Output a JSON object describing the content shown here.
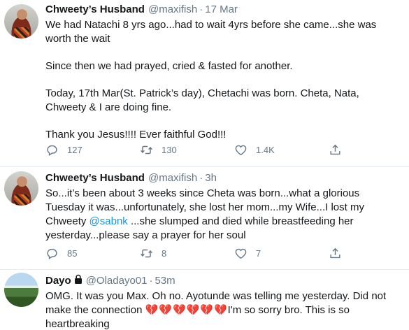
{
  "tweets": [
    {
      "name": "Chweety’s Husband",
      "handle": "@maxifish",
      "time": "17 Mar",
      "paragraphs": [
        "We had Natachi 8 yrs ago...had to wait 4yrs before she came...she was worth the wait",
        "Since then we had prayed, cried & fasted for another.",
        "Today, 17th Mar(St. Patrick’s day), Chetachi was born. Cheta, Nata, Chweety & I are doing fine.",
        "Thank you Jesus!!!! Ever faithful God!!!"
      ],
      "replies": "127",
      "retweets": "130",
      "likes": "1.4K"
    },
    {
      "name": "Chweety’s Husband",
      "handle": "@maxifish",
      "time": "3h",
      "text_before": "So...it’s been about 3 weeks since Cheta was born...what a glorious Tuesday it was...unfortunately, she lost her mom...my Wife...I lost my Chweety ",
      "mention": "@sabnk",
      "text_after": " ...she slumped and died while breastfeeding her yesterday...please say a prayer for her soul",
      "replies": "85",
      "retweets": "8",
      "likes": "7"
    },
    {
      "name": "Dayo",
      "handle": "@Oladayo01",
      "time": "53m",
      "text_before": "OMG. It was you Max. Oh no. Ayotunde was telling me yesterday. Did not make the connection ",
      "emoji": "💔💔💔💔💔💔",
      "text_after": "I'm so sorry bro. This is so heartbreaking"
    }
  ],
  "separator": "·",
  "icons": {
    "reply": "reply-icon",
    "retweet": "retweet-icon",
    "like": "heart-icon",
    "share": "share-icon",
    "lock": "lock-icon"
  },
  "colors": {
    "text": "#14171a",
    "secondary": "#657786",
    "link": "#1b95e0",
    "divider": "#e6ecf0"
  }
}
